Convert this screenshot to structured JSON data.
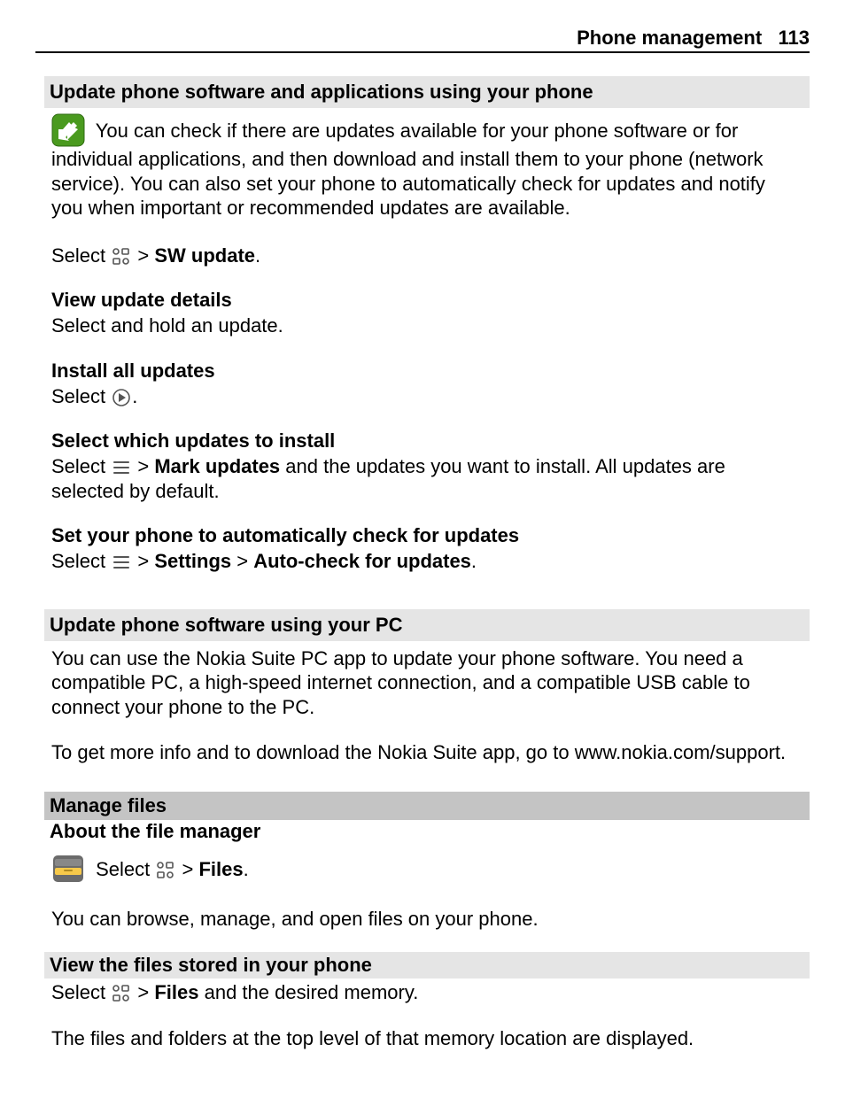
{
  "header": {
    "title": "Phone management",
    "page": "113"
  },
  "s1": {
    "title": "Update phone software and applications using your phone",
    "intro_a": " You can check if there are updates available for your phone software or for individual applications, and then download and install them to your phone (network service). You can also set your phone to automatically check for updates and notify you when important or recommended updates are available.",
    "select_word": "Select ",
    "gt": " > ",
    "sw_update": "SW update",
    "period": "."
  },
  "view_details": {
    "title": "View update details",
    "body": "Select and hold an update."
  },
  "install_all": {
    "title": "Install all updates",
    "body_a": "Select ",
    "body_b": "."
  },
  "select_which": {
    "title": "Select which updates to install",
    "a": "Select ",
    "gt": " > ",
    "mark": "Mark updates",
    "b": " and the updates you want to install. All updates are selected by default."
  },
  "auto_check": {
    "title": "Set your phone to automatically check for updates",
    "a": "Select ",
    "gt1": " > ",
    "settings": "Settings",
    "gt2": "  > ",
    "auto": "Auto-check for updates",
    "end": "."
  },
  "s2": {
    "title": "Update phone software using your PC",
    "p1": "You can use the Nokia Suite PC app to update your phone software. You need a compatible PC, a high-speed internet connection, and a compatible USB cable to connect your phone to the PC.",
    "p2": "To get more info and to download the Nokia Suite app, go to www.nokia.com/support."
  },
  "manage": {
    "title": "Manage files",
    "sub": "About the file manager",
    "a": " Select ",
    "gt": " > ",
    "files": "Files",
    "end": ".",
    "p2": "You can browse, manage, and open files on your phone."
  },
  "view_files": {
    "title": "View the files stored in your phone",
    "a": "Select ",
    "gt": " > ",
    "files": "Files",
    "b": " and the desired memory.",
    "p2": "The files and folders at the top level of that memory location are displayed."
  }
}
